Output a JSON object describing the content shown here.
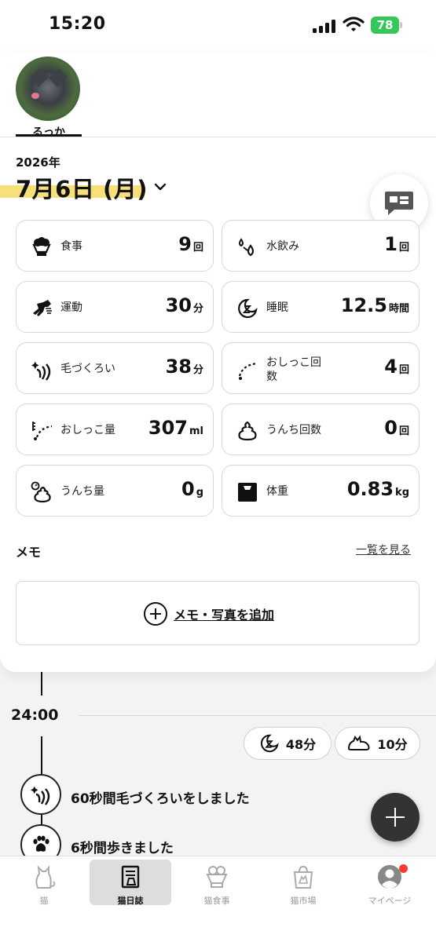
{
  "status_bar": {
    "time": "15:20",
    "battery": "78"
  },
  "cat_tabs": [
    {
      "name": "るっか"
    }
  ],
  "header": {
    "year": "2026年",
    "date": "7月6日 (月)"
  },
  "stats": [
    {
      "label": "食事",
      "value": "9",
      "unit": "回",
      "icon": "food-bowl-icon"
    },
    {
      "label": "水飲み",
      "value": "1",
      "unit": "回",
      "icon": "water-drop-icon"
    },
    {
      "label": "運動",
      "value": "30",
      "unit": "分",
      "icon": "running-cat-icon"
    },
    {
      "label": "睡眠",
      "value": "12.5",
      "unit": "時間",
      "icon": "sleep-z-icon"
    },
    {
      "label": "毛づくろい",
      "value": "38",
      "unit": "分",
      "icon": "grooming-icon"
    },
    {
      "label": "おしっこ回数",
      "value": "4",
      "unit": "回",
      "icon": "pee-count-icon"
    },
    {
      "label": "おしっこ量",
      "value": "307",
      "unit": "ml",
      "icon": "pee-amount-icon"
    },
    {
      "label": "うんち回数",
      "value": "0",
      "unit": "回",
      "icon": "poop-count-icon"
    },
    {
      "label": "うんち量",
      "value": "0",
      "unit": "g",
      "icon": "poop-amount-icon"
    },
    {
      "label": "体重",
      "value": "0.83",
      "unit": "kg",
      "icon": "scale-icon"
    }
  ],
  "memo": {
    "heading": "メモ",
    "view_all": "一覧を見る",
    "add_label": "メモ・写真を追加"
  },
  "timeline": {
    "hour": "24:00",
    "pills": [
      {
        "label": "48分",
        "icon": "sleep-z-icon"
      },
      {
        "label": "10分",
        "icon": "cat-lying-icon"
      }
    ],
    "events": [
      {
        "text": "60秒間毛づくろいをしました",
        "icon": "grooming-icon"
      },
      {
        "text": "6秒間歩きました",
        "icon": "paw-icon"
      }
    ]
  },
  "tabbar": {
    "items": [
      {
        "label": "猫",
        "icon": "cat-icon"
      },
      {
        "label": "猫日誌",
        "icon": "diary-icon",
        "active": true
      },
      {
        "label": "猫食事",
        "icon": "food-bowl-icon"
      },
      {
        "label": "猫市場",
        "icon": "shopping-bag-icon"
      },
      {
        "label": "マイページ",
        "icon": "user-icon",
        "badge": true
      }
    ]
  },
  "colors": {
    "highlight": "#f7e07a",
    "battery": "#35c759",
    "badge": "#ff3b30",
    "fab": "#333333"
  }
}
